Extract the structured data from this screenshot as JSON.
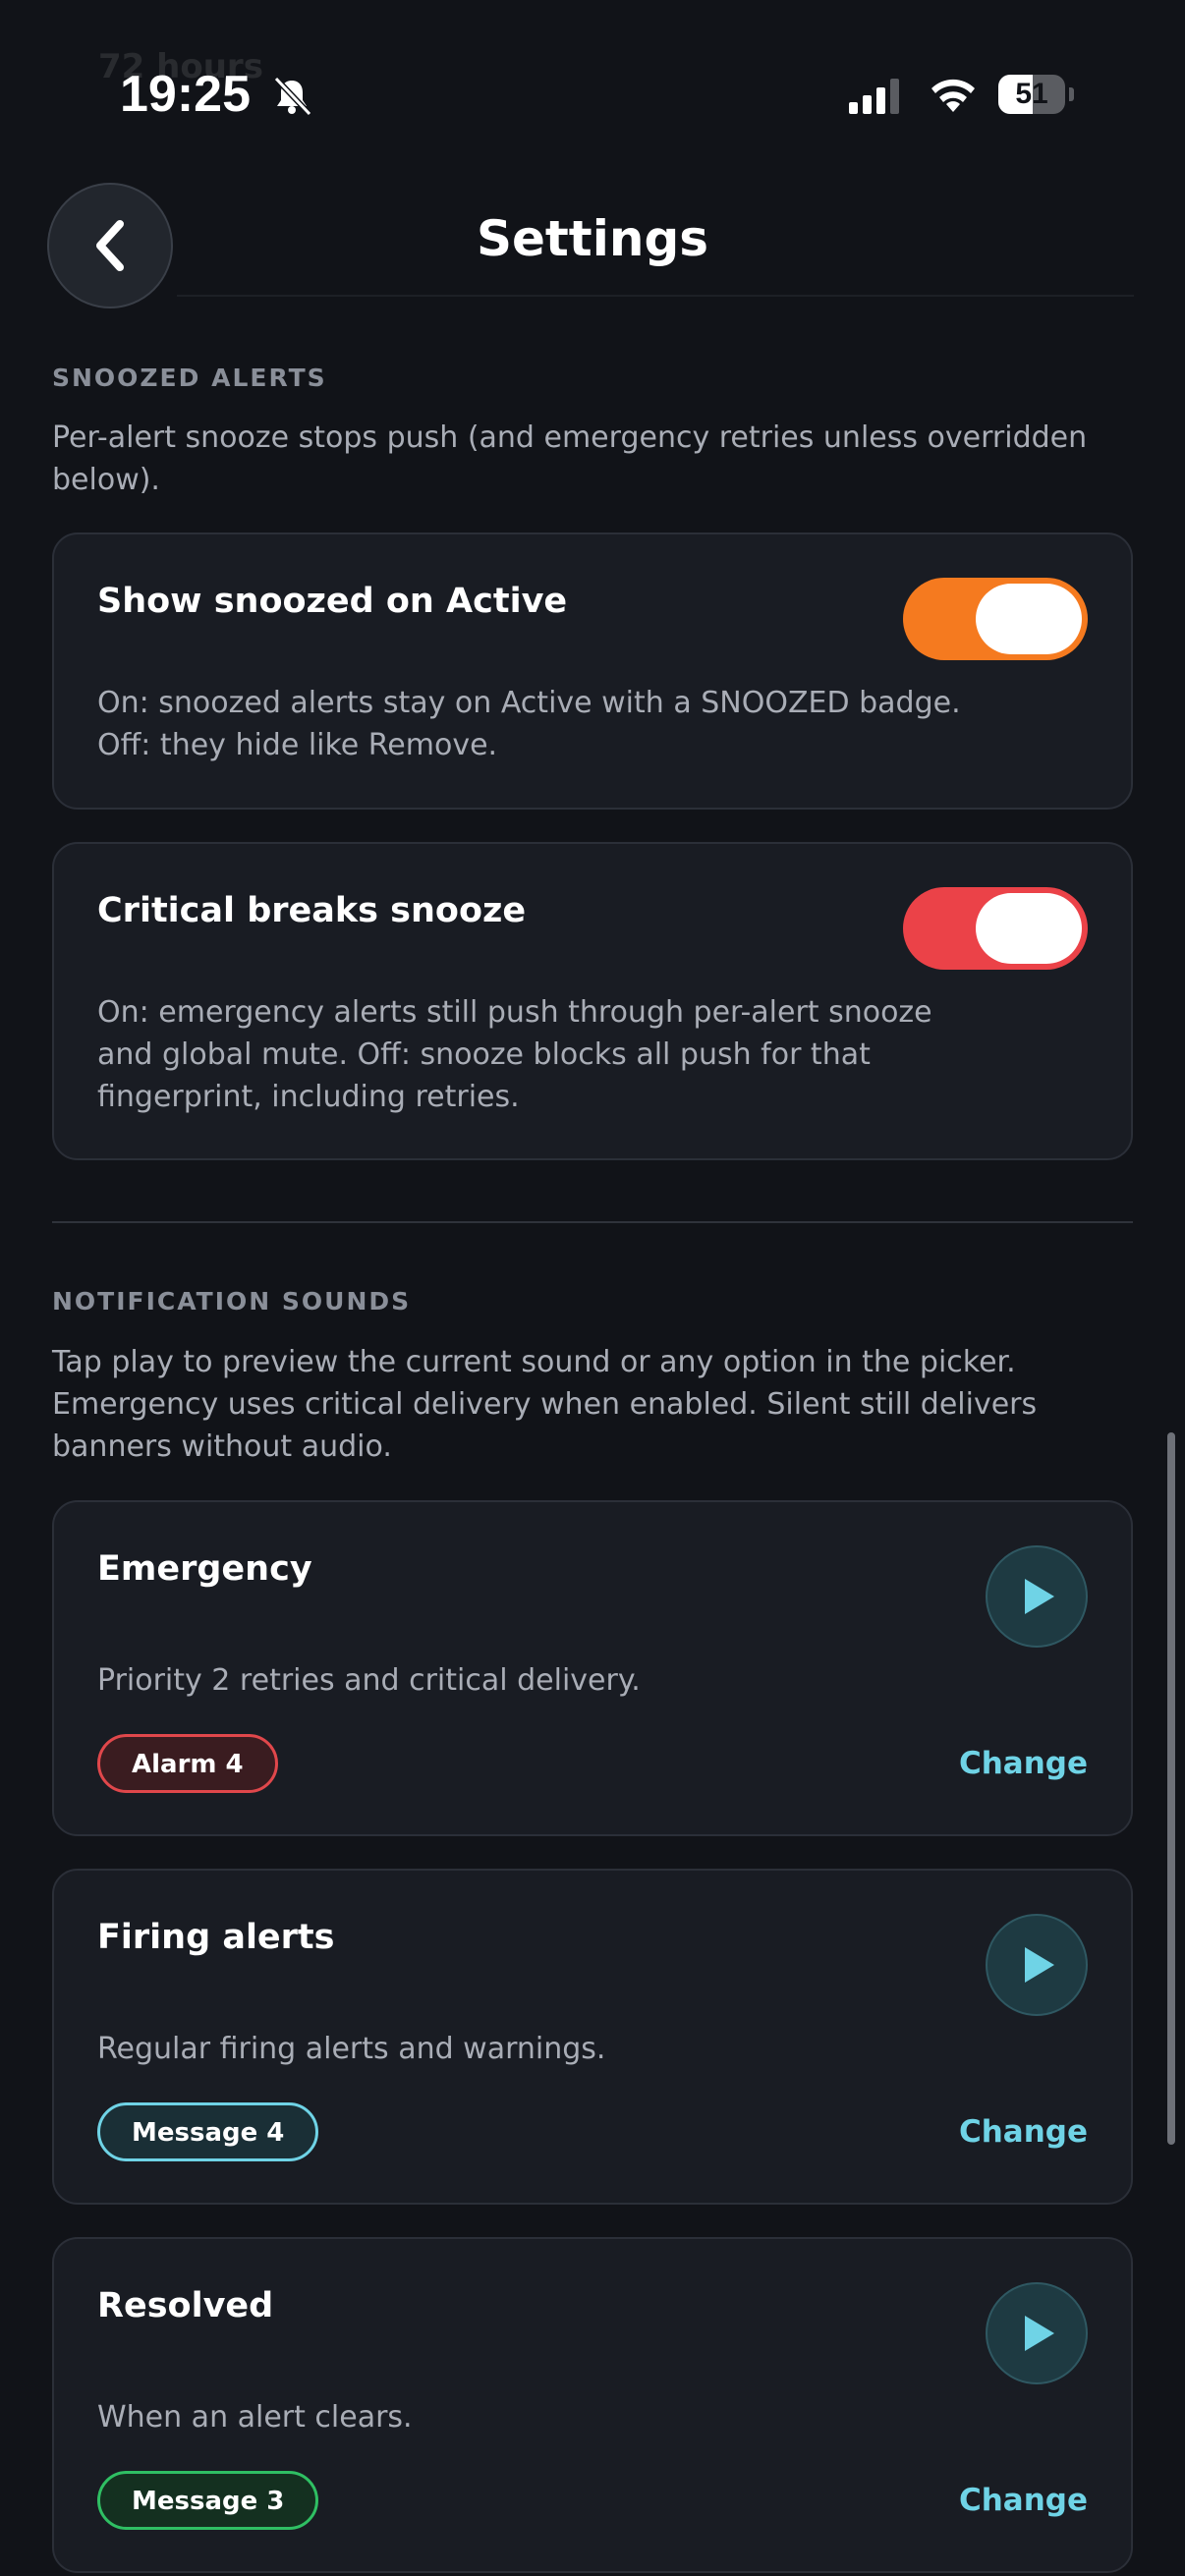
{
  "status_bar": {
    "time": "19:25",
    "battery": "51",
    "battery_level": 0.51
  },
  "ghost_text": "72 hours",
  "header": {
    "title": "Settings"
  },
  "snoozed": {
    "heading": "SNOOZED ALERTS",
    "description": "Per-alert snooze stops push (and emergency retries unless overridden below).",
    "cards": [
      {
        "title": "Show snoozed on Active",
        "description": "On: snoozed alerts stay on Active with a SNOOZED badge. Off: they hide like Remove.",
        "toggle_on": true,
        "toggle_color": "#f57a1f"
      },
      {
        "title": "Critical breaks snooze",
        "description": "On: emergency alerts still push through per-alert snooze and global mute. Off: snooze blocks all push for that fingerprint, including retries.",
        "toggle_on": true,
        "toggle_color": "#eb4248"
      }
    ]
  },
  "sounds": {
    "heading": "NOTIFICATION SOUNDS",
    "description": "Tap play to preview the current sound or any option in the picker. Emergency uses critical delivery when enabled. Silent still delivers banners without audio.",
    "change_label": "Change",
    "cards": [
      {
        "title": "Emergency",
        "description": "Priority 2 retries and critical delivery.",
        "sound": "Alarm 4",
        "badge_border": "#e0474b",
        "badge_bg": "#3a1c20"
      },
      {
        "title": "Firing alerts",
        "description": "Regular firing alerts and warnings.",
        "sound": "Message 4",
        "badge_border": "#6fd3e6",
        "badge_bg": "#1a2f36"
      },
      {
        "title": "Resolved",
        "description": "When an alert clears.",
        "sound": "Message 3",
        "badge_border": "#2fbf63",
        "badge_bg": "#143020"
      }
    ]
  },
  "colors": {
    "accent": "#6fd3e6",
    "background": "#111318",
    "card": "#191c23"
  }
}
